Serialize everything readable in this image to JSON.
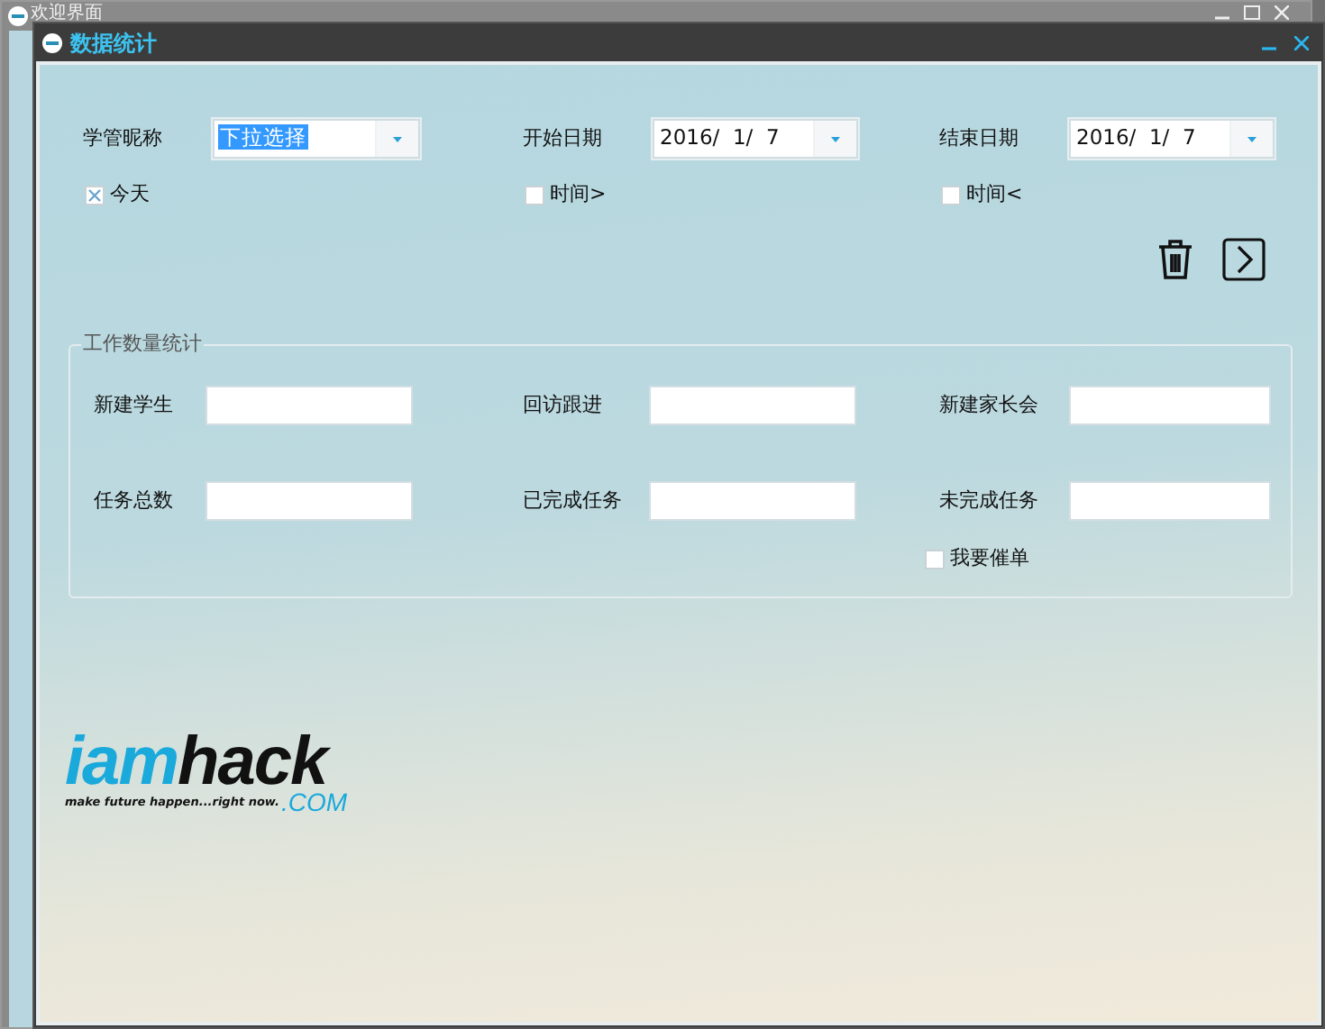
{
  "background_window": {
    "title": "欢迎界面"
  },
  "window": {
    "title": "数据统计"
  },
  "filters": [
    {
      "kind": "select",
      "label": "学管昵称",
      "value": "下拉选择",
      "value_selected": true,
      "checkbox": {
        "label": "今天",
        "checked": true
      }
    },
    {
      "kind": "date",
      "label": "开始日期",
      "value": "2016/  1/  7",
      "checkbox": {
        "label": "时间>",
        "checked": false
      }
    },
    {
      "kind": "date",
      "label": "结束日期",
      "value": "2016/  1/  7",
      "checkbox": {
        "label": "时间<",
        "checked": false
      }
    }
  ],
  "group": {
    "title": "工作数量统计",
    "fields": [
      {
        "label": "新建学生"
      },
      {
        "label": "回访跟进"
      },
      {
        "label": "新建家长会"
      },
      {
        "label": "任务总数"
      },
      {
        "label": "已完成任务"
      },
      {
        "label": "未完成任务"
      }
    ],
    "checkbox": {
      "label": "我要催单",
      "checked": false
    }
  },
  "logo": {
    "brand_part_1": "iam",
    "brand_part_2": "hack",
    "tagline": "make future happen...right now.",
    "suffix": ".COM"
  }
}
